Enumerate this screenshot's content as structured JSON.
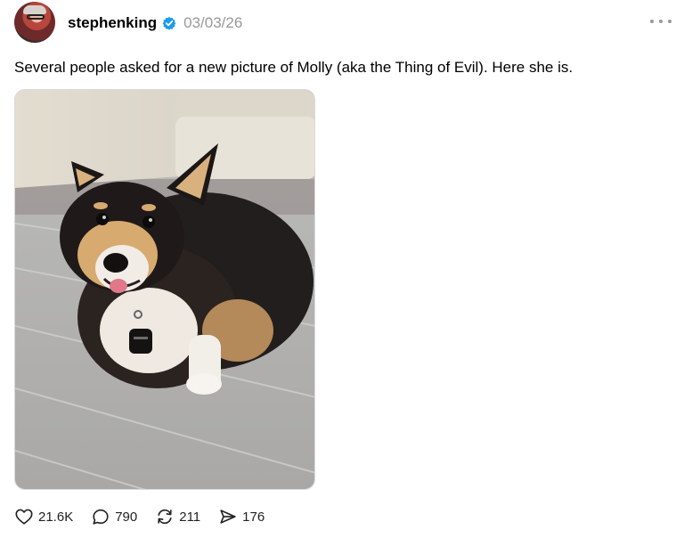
{
  "post": {
    "username": "stephenking",
    "timestamp": "03/03/26",
    "text": "Several people asked for a new picture of Molly (aka the Thing of Evil). Here she is.",
    "icons": {
      "avatar": "profile-photo",
      "verified": "verified-badge-icon",
      "more": "more-options-icon",
      "image": "corgi-photo"
    },
    "colors": {
      "verified": "#1D9BF0",
      "timestamp": "#999999",
      "text": "#000000"
    }
  },
  "actions": {
    "like": {
      "icon": "heart-icon",
      "count": "21.6K"
    },
    "reply": {
      "icon": "comment-icon",
      "count": "790"
    },
    "repost": {
      "icon": "repost-icon",
      "count": "211"
    },
    "share": {
      "icon": "send-icon",
      "count": "176"
    }
  }
}
